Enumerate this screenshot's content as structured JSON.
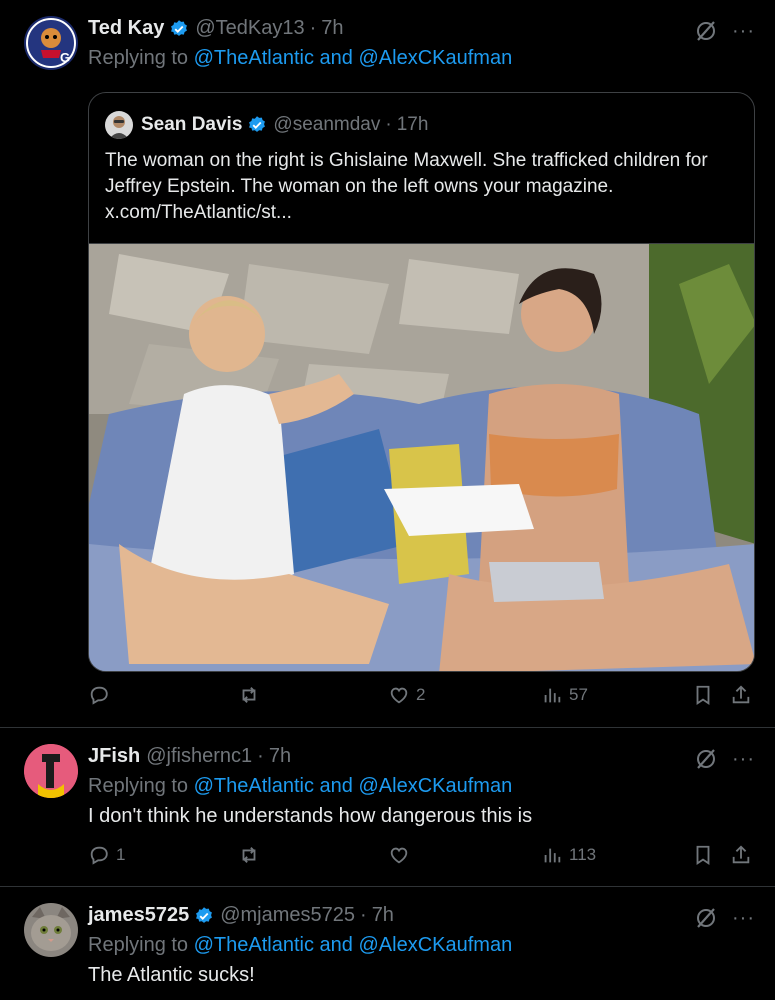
{
  "posts": [
    {
      "display_name": "Ted Kay",
      "handle": "@TedKay13",
      "time": "7h",
      "replying_prefix": "Replying to",
      "mention1": "@TheAtlantic",
      "and": "and",
      "mention2": "@AlexCKaufman",
      "verified": true,
      "quote": {
        "display_name": "Sean Davis",
        "handle": "@seanmdav",
        "time": "17h",
        "text": "The woman on the right is Ghislaine Maxwell. She trafficked children for Jeffrey Epstein. The woman on the left owns your magazine.",
        "link": "x.com/TheAtlantic/st..."
      },
      "replies": "",
      "reposts": "",
      "likes": "2",
      "views": "57"
    },
    {
      "display_name": "JFish",
      "handle": "@jfishernc1",
      "time": "7h",
      "replying_prefix": "Replying to",
      "mention1": "@TheAtlantic",
      "and": "and",
      "mention2": "@AlexCKaufman",
      "text": "I don't think he understands how dangerous this is",
      "replies": "1",
      "reposts": "",
      "likes": "",
      "views": "113"
    },
    {
      "display_name": "james5725",
      "handle": "@mjames5725",
      "time": "7h",
      "replying_prefix": "Replying to",
      "mention1": "@TheAtlantic",
      "and": "and",
      "mention2": "@AlexCKaufman",
      "text": "The Atlantic sucks!",
      "verified": true
    }
  ],
  "separator": "·",
  "more_glyph": "···",
  "colors": {
    "background": "#000000",
    "text": "#e7e9ea",
    "muted": "#71767b",
    "link": "#1d9bf0",
    "verified": "#1d9bf0",
    "border": "#2f3336"
  },
  "icons": [
    "verified-badge-icon",
    "grok-icon",
    "more-icon",
    "reply-icon",
    "repost-icon",
    "like-icon",
    "views-icon",
    "bookmark-icon",
    "share-icon"
  ]
}
